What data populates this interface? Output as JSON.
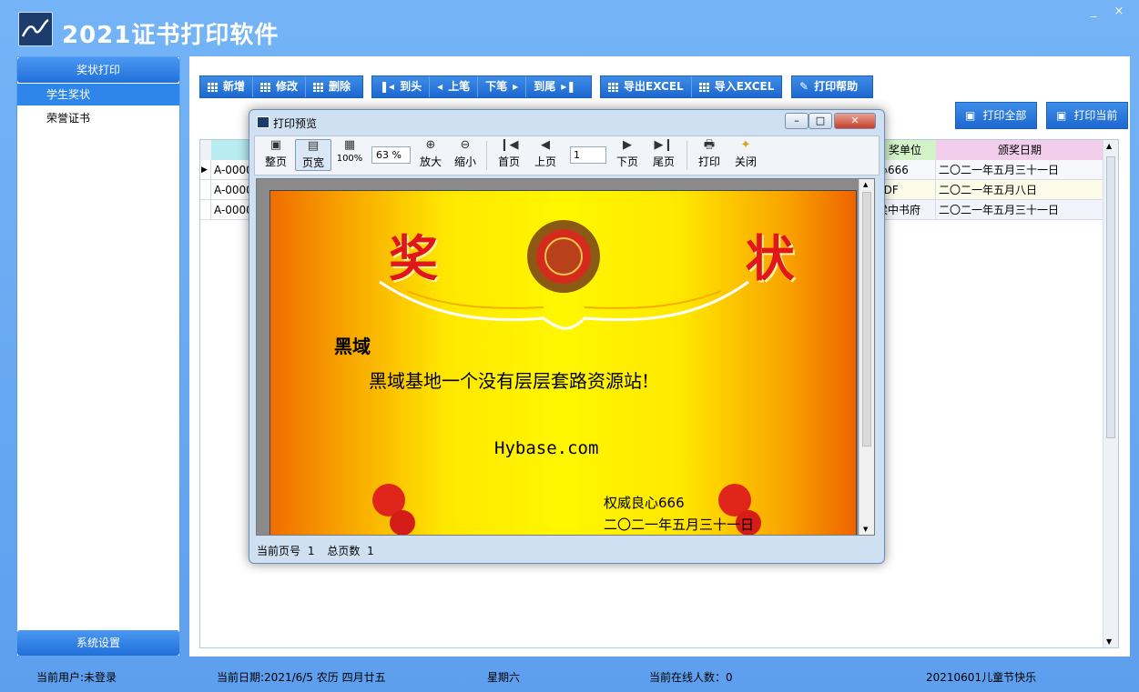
{
  "app": {
    "title": "2021证书打印软件",
    "window_controls": [
      "_",
      "□",
      "×"
    ]
  },
  "sidebar": {
    "section1": "奖状打印",
    "items": [
      {
        "label": "学生奖状",
        "active": true
      },
      {
        "label": "荣誉证书",
        "active": false
      }
    ],
    "section2": "系统设置"
  },
  "toolbar": {
    "new": "新增",
    "edit": "修改",
    "delete": "删除",
    "first": "到头",
    "prev": "上笔",
    "next": "下笔",
    "last": "到尾",
    "export_excel": "导出EXCEL",
    "import_excel": "导入EXCEL",
    "print_help": "打印帮助",
    "print_all": "打印全部",
    "print_current": "打印当前"
  },
  "grid": {
    "columns": [
      "",
      "奖单位",
      "颁奖日期"
    ],
    "rows": [
      {
        "id": "A-0000",
        "unit": "心666",
        "date": "二〇二一年五月三十一日"
      },
      {
        "id": "A-0000",
        "unit": "SDF",
        "date": "二〇二一年五月八日"
      },
      {
        "id": "A-0000",
        "unit": "梁中书府",
        "date": "二〇二一年五月三十一日"
      }
    ]
  },
  "preview": {
    "title": "打印预览",
    "tools": {
      "whole_page": "整页",
      "page_width": "页宽",
      "hundred": "100%",
      "zoom_value": "63",
      "zoom_unit": "%",
      "zoom_in": "放大",
      "zoom_out": "缩小",
      "first_page": "首页",
      "prev_page": "上页",
      "page_value": "1",
      "next_page": "下页",
      "last_page": "尾页",
      "print": "打印",
      "close": "关闭"
    },
    "status": {
      "current_page_label": "当前页号",
      "current_page": "1",
      "total_pages_label": "总页数",
      "total_pages": "1"
    },
    "certificate": {
      "heading": "奖  状",
      "recipient": "黑域",
      "body": "黑域基地一个没有层层套路资源站!",
      "url": "Hybase.com",
      "issuer": "权威良心666",
      "date": "二〇二一年五月三十一日"
    }
  },
  "status": {
    "user": "当前用户:未登录",
    "date": "当前日期:2021/6/5   农历 四月廿五",
    "weekday": "星期六",
    "online": "当前在线人数：0",
    "note": "20210601儿童节快乐"
  }
}
